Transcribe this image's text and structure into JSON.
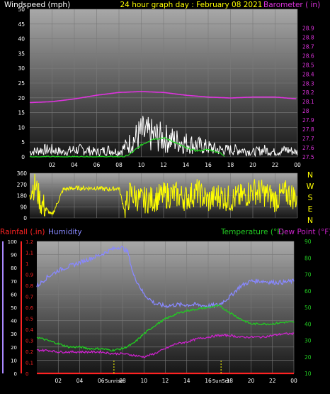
{
  "header": {
    "left": "Windspeed (mph)",
    "center": "24 hour graph day : February 08 2021",
    "right": "Barometer ( in)"
  },
  "colors": {
    "background": "#000000",
    "plot_top": "#a8a8a8",
    "plot_bottom": "#1a1a1a",
    "grid": "#7a7a7a",
    "white": "#ffffff",
    "barometer": "#dd33dd",
    "wind_avg": "#22dd22",
    "direction": "#ffff00",
    "rainfall": "#ff2222",
    "humidity": "#8888ff",
    "temperature": "#22cc22",
    "dewpoint": "#cc22cc",
    "label_purple": "#aa88ff",
    "sun_marker": "#ffff00"
  },
  "x_axis": {
    "ticks": [
      "02",
      "04",
      "06",
      "08",
      "10",
      "12",
      "14",
      "16",
      "18",
      "20",
      "22",
      "00"
    ],
    "tick_hours": [
      2,
      4,
      6,
      8,
      10,
      12,
      14,
      16,
      18,
      20,
      22,
      24
    ]
  },
  "compass": [
    "N",
    "W",
    "S",
    "E",
    "N"
  ],
  "bottom_labels": {
    "rainfall": "Rainfall (.in)",
    "humidity": "Humidity",
    "temperature": "Temperature (°F)",
    "dewpoint": "Dew Point (°F)",
    "sunrise": "Sunrise",
    "sunset": "SunSet"
  },
  "chart_data": [
    {
      "type": "line",
      "name": "wind-barometer",
      "title": "Windspeed (mph) / Barometer ( in)",
      "xlabel": "",
      "ylabel": "Windspeed (mph)",
      "ylabel_right": "Barometer ( in)",
      "xlim": [
        0,
        24
      ],
      "ylim": [
        0,
        50
      ],
      "y2lim": [
        27.5,
        29.0
      ],
      "y_ticks": [
        0,
        5,
        10,
        15,
        20,
        25,
        30,
        35,
        40,
        45,
        50
      ],
      "y2_ticks": [
        27.5,
        27.6,
        27.7,
        27.8,
        27.9,
        28.0,
        28.1,
        28.2,
        28.3,
        28.4,
        28.5,
        28.6,
        28.7,
        28.8,
        28.9
      ],
      "y2_tick_labels": [
        "27.5",
        "27.6",
        "27.7",
        "27.8",
        "27.9",
        "28",
        "28.1",
        "28.2",
        "28.3",
        "28.4",
        "28.5",
        "28.6",
        "28.7",
        "28.8",
        "28.9"
      ],
      "grid": true,
      "series": [
        {
          "name": "Windspeed (mph)",
          "axis": "left",
          "color": "#ffffff",
          "x": [
            0,
            1,
            2,
            3,
            4,
            5,
            6,
            7,
            8,
            9,
            10,
            11,
            12,
            13,
            14,
            15,
            16,
            17,
            18,
            19,
            20,
            21,
            22,
            23,
            24
          ],
          "y": [
            2,
            3,
            3,
            2,
            3,
            3,
            2,
            3,
            2,
            6,
            10,
            9,
            8,
            7,
            6,
            5,
            4,
            3,
            3,
            3,
            2,
            3,
            2,
            3,
            2
          ]
        },
        {
          "name": "Average wind (mph)",
          "axis": "left",
          "color": "#22dd22",
          "x": [
            0,
            2,
            4,
            6,
            8,
            8.5,
            9,
            10,
            11,
            12,
            13,
            14,
            15,
            16,
            17,
            17.5
          ],
          "y": [
            0,
            0,
            0,
            0,
            0,
            0,
            1,
            4,
            6,
            6.5,
            5,
            3,
            2,
            2.5,
            1.5,
            0
          ]
        },
        {
          "name": "Barometer ( in)",
          "axis": "right",
          "color": "#dd33dd",
          "x": [
            0,
            2,
            4,
            6,
            8,
            10,
            12,
            14,
            16,
            18,
            20,
            22,
            24
          ],
          "y": [
            28.09,
            28.1,
            28.13,
            28.17,
            28.2,
            28.21,
            28.2,
            28.17,
            28.15,
            28.14,
            28.15,
            28.15,
            28.13
          ]
        }
      ]
    },
    {
      "type": "line",
      "name": "wind-direction",
      "title": "",
      "xlabel": "",
      "ylabel": "",
      "xlim": [
        0,
        24
      ],
      "ylim": [
        0,
        360
      ],
      "y_ticks": [
        0,
        90,
        180,
        270,
        360
      ],
      "grid": true,
      "series": [
        {
          "name": "Wind direction",
          "color": "#ffff00",
          "x": [
            0,
            0.5,
            1,
            2,
            3,
            4,
            5,
            6,
            7,
            8,
            8.5,
            9,
            10,
            11,
            12,
            13,
            14,
            15,
            16,
            17,
            18,
            19,
            20,
            21,
            22,
            23,
            24
          ],
          "y": [
            230,
            260,
            120,
            20,
            230,
            240,
            240,
            240,
            230,
            240,
            60,
            200,
            140,
            150,
            180,
            190,
            160,
            210,
            140,
            180,
            150,
            170,
            220,
            200,
            150,
            200,
            160
          ]
        }
      ]
    },
    {
      "type": "line",
      "name": "temp-humidity-rain",
      "title": "Temperature (°F) / Dew Point (°F) / Humidity / Rainfall (.in)",
      "xlabel": "",
      "ylabel": "Rainfall (.in)",
      "ylabel_right": "Temperature (°F)",
      "xlim": [
        0,
        24
      ],
      "ylim": [
        0,
        100
      ],
      "y_ticks": [
        0,
        10,
        20,
        30,
        40,
        50,
        60,
        70,
        80,
        90,
        100
      ],
      "rain_ylim": [
        0,
        1.2
      ],
      "rain_ticks": [
        0,
        0.1,
        0.2,
        0.3,
        0.4,
        0.5,
        0.6,
        0.7,
        0.8,
        0.9,
        1,
        1.1,
        1.2
      ],
      "rain_tick_labels": [
        "0",
        "0.1",
        "0.2",
        "0.3",
        "0.4",
        "0.5",
        "0.6",
        "0.7",
        "0.8",
        "0.9",
        "1",
        "1.1",
        "1.2"
      ],
      "temp_ylim": [
        10,
        90
      ],
      "temp_ticks": [
        10,
        20,
        30,
        40,
        50,
        60,
        70,
        80,
        90
      ],
      "grid": true,
      "sunrise_hour": 7.2,
      "sunset_hour": 17.2,
      "series": [
        {
          "name": "Humidity",
          "scale": "percent",
          "color": "#8888ff",
          "x": [
            0,
            1,
            2,
            3,
            4,
            5,
            6,
            7,
            7.8,
            8.5,
            9,
            10,
            11,
            12,
            13,
            14,
            15,
            16,
            17,
            18,
            19,
            20,
            21,
            22,
            23,
            24
          ],
          "y": [
            66,
            73,
            78,
            81,
            84,
            87,
            90,
            94,
            96,
            92,
            75,
            60,
            53,
            51,
            52,
            52,
            52,
            51,
            52,
            58,
            66,
            70,
            70,
            69,
            69,
            70
          ]
        },
        {
          "name": "Temperature (°F)",
          "scale": "temp",
          "color": "#22cc22",
          "x": [
            0,
            1,
            2,
            3,
            4,
            5,
            6,
            7,
            8,
            9,
            10,
            11,
            12,
            13,
            14,
            15,
            16,
            17,
            18,
            19,
            20,
            21,
            22,
            23,
            24
          ],
          "y": [
            32,
            30,
            28,
            26,
            26,
            25,
            25,
            24,
            25,
            28,
            34,
            39,
            43,
            46,
            48,
            49,
            50,
            51,
            47,
            43,
            40,
            40,
            40,
            41,
            41
          ]
        },
        {
          "name": "Dew Point (°F)",
          "scale": "temp",
          "color": "#cc22cc",
          "x": [
            0,
            1,
            2,
            3,
            4,
            5,
            6,
            7,
            8,
            9,
            10,
            11,
            12,
            13,
            14,
            15,
            16,
            17,
            18,
            19,
            20,
            21,
            22,
            23,
            24
          ],
          "y": [
            24,
            24,
            23,
            23,
            23,
            23,
            23,
            22,
            22,
            21,
            20,
            22,
            25,
            28,
            29,
            31,
            32,
            33,
            33,
            32,
            32,
            32,
            33,
            34,
            34
          ]
        },
        {
          "name": "Rainfall (.in)",
          "scale": "rain",
          "color": "#ff2222",
          "x": [
            0,
            24
          ],
          "y": [
            0,
            0
          ]
        }
      ]
    }
  ]
}
